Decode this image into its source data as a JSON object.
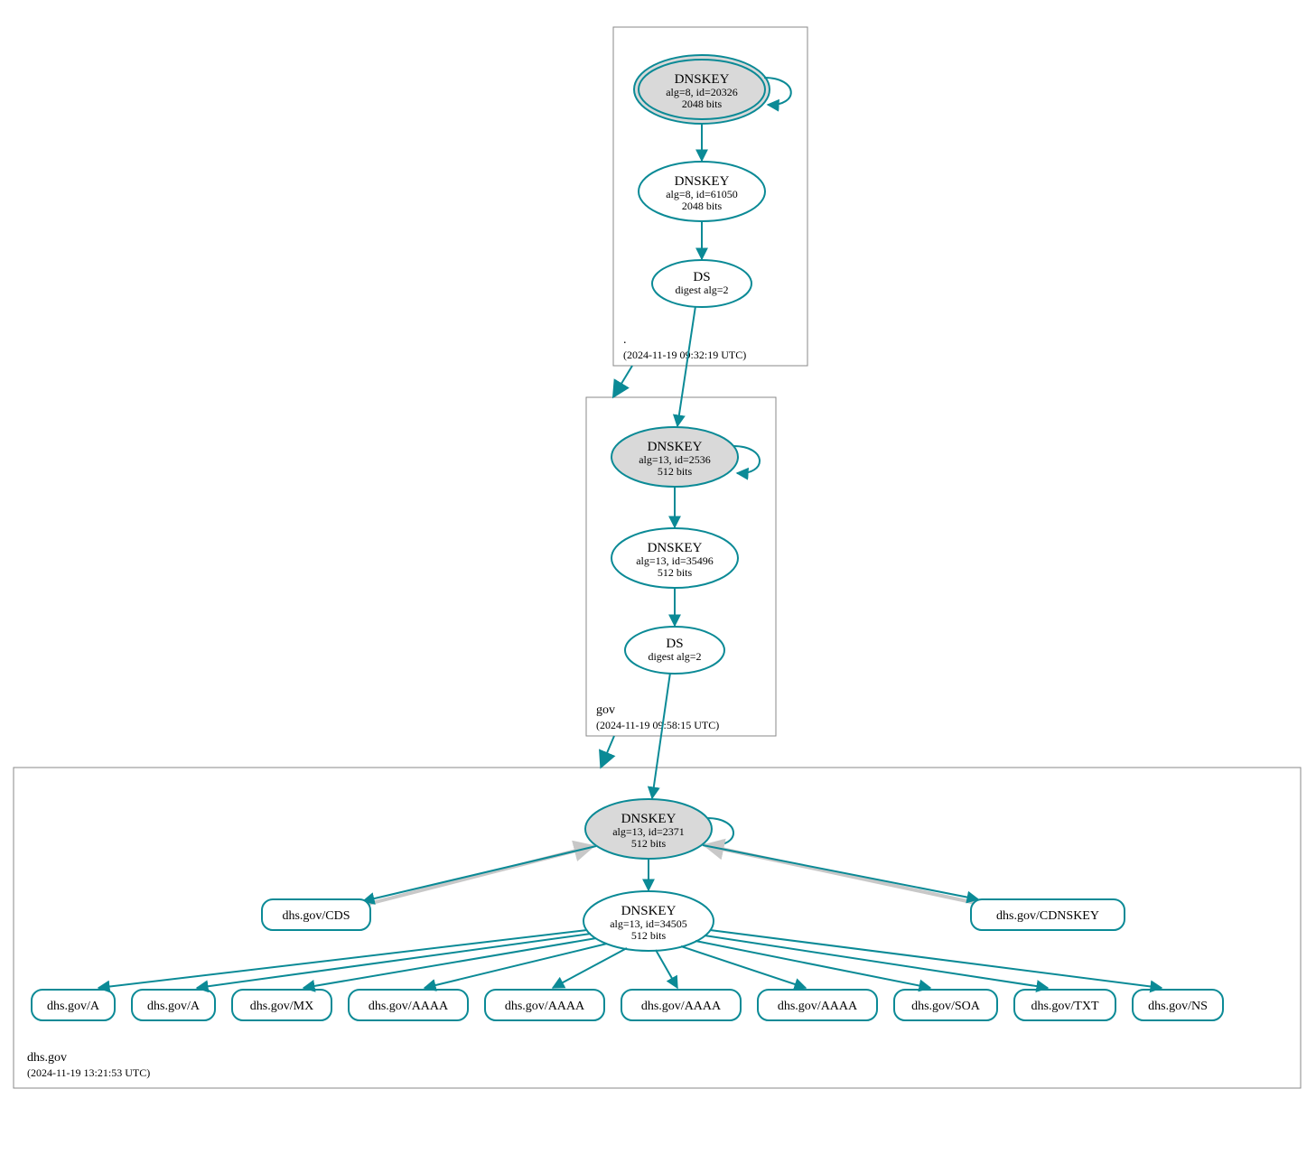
{
  "zones": {
    "root": {
      "name": ".",
      "timestamp": "(2024-11-19 09:32:19 UTC)"
    },
    "gov": {
      "name": "gov",
      "timestamp": "(2024-11-19 09:58:15 UTC)"
    },
    "dhs": {
      "name": "dhs.gov",
      "timestamp": "(2024-11-19 13:21:53 UTC)"
    }
  },
  "nodes": {
    "root_ksk": {
      "title": "DNSKEY",
      "l1": "alg=8, id=20326",
      "l2": "2048 bits"
    },
    "root_zsk": {
      "title": "DNSKEY",
      "l1": "alg=8, id=61050",
      "l2": "2048 bits"
    },
    "root_ds": {
      "title": "DS",
      "l1": "digest alg=2"
    },
    "gov_ksk": {
      "title": "DNSKEY",
      "l1": "alg=13, id=2536",
      "l2": "512 bits"
    },
    "gov_zsk": {
      "title": "DNSKEY",
      "l1": "alg=13, id=35496",
      "l2": "512 bits"
    },
    "gov_ds": {
      "title": "DS",
      "l1": "digest alg=2"
    },
    "dhs_ksk": {
      "title": "DNSKEY",
      "l1": "alg=13, id=2371",
      "l2": "512 bits"
    },
    "dhs_zsk": {
      "title": "DNSKEY",
      "l1": "alg=13, id=34505",
      "l2": "512 bits"
    }
  },
  "rr": {
    "cds": "dhs.gov/CDS",
    "cdnskey": "dhs.gov/CDNSKEY",
    "a1": "dhs.gov/A",
    "a2": "dhs.gov/A",
    "mx": "dhs.gov/MX",
    "aaaa1": "dhs.gov/AAAA",
    "aaaa2": "dhs.gov/AAAA",
    "aaaa3": "dhs.gov/AAAA",
    "aaaa4": "dhs.gov/AAAA",
    "soa": "dhs.gov/SOA",
    "txt": "dhs.gov/TXT",
    "ns": "dhs.gov/NS"
  }
}
